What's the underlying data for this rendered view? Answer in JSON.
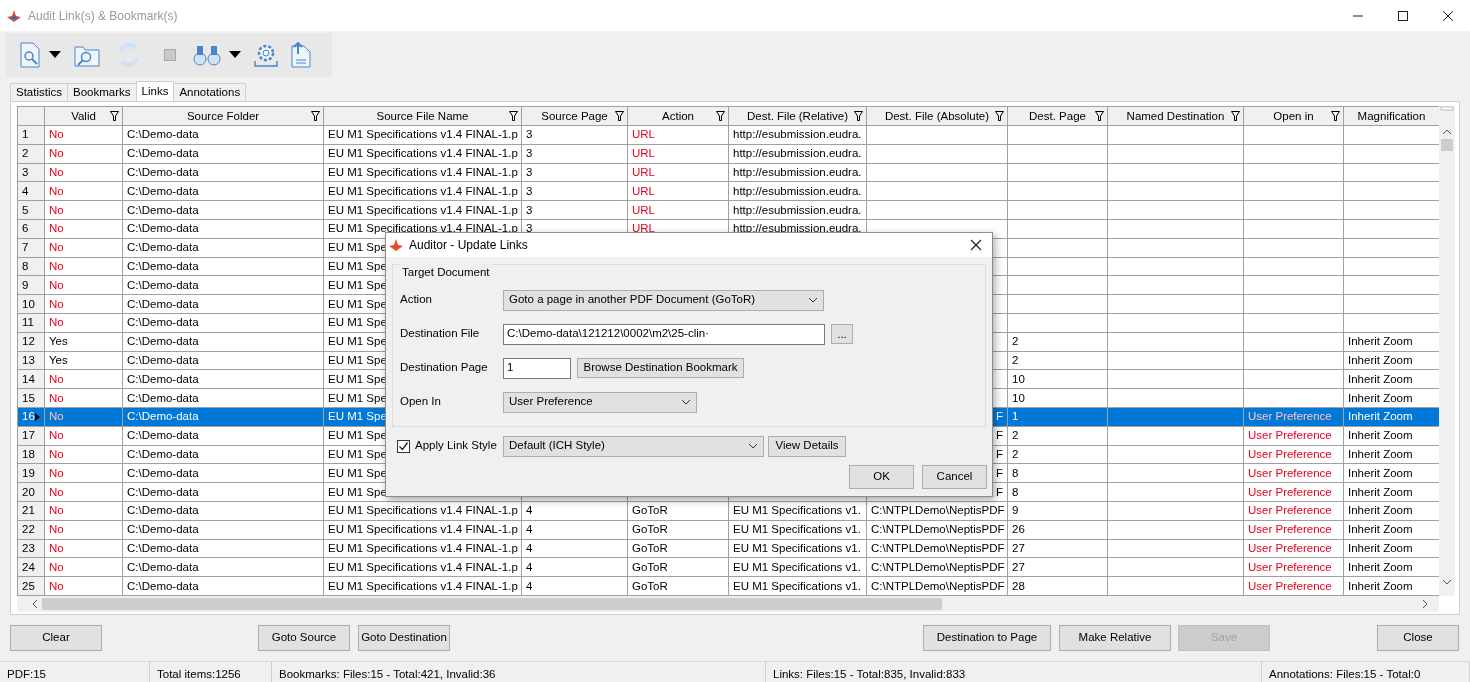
{
  "window": {
    "title": "Audit Link(s) & Bookmark(s)"
  },
  "tabs": [
    {
      "label": "Statistics",
      "selected": false
    },
    {
      "label": "Bookmarks",
      "selected": false
    },
    {
      "label": "Links",
      "selected": true
    },
    {
      "label": "Annotations",
      "selected": false
    }
  ],
  "table": {
    "columns": [
      {
        "label": "Valid",
        "filter": true
      },
      {
        "label": "Source Folder",
        "filter": true
      },
      {
        "label": "Source File Name",
        "filter": true
      },
      {
        "label": "Source Page",
        "filter": true
      },
      {
        "label": "Action",
        "filter": true
      },
      {
        "label": "Dest. File (Relative)",
        "filter": true
      },
      {
        "label": "Dest. File (Absolute)",
        "filter": true
      },
      {
        "label": "Dest. Page",
        "filter": true
      },
      {
        "label": "Named Destination",
        "filter": true
      },
      {
        "label": "Open in",
        "filter": true
      },
      {
        "label": "Magnification",
        "filter": false
      }
    ],
    "rows": [
      {
        "number": "1",
        "valid": "No",
        "invalid": true,
        "source_folder": "C:\\Demo-data",
        "source_file": "EU M1 Specifications v1.4 FINAL-1.p",
        "source_page": "3",
        "action": "URL",
        "action_flagged": true,
        "dest_relative": "http://esubmission.eudra.",
        "selected": false
      },
      {
        "number": "2",
        "valid": "No",
        "invalid": true,
        "source_folder": "C:\\Demo-data",
        "source_file": "EU M1 Specifications v1.4 FINAL-1.p",
        "source_page": "3",
        "action": "URL",
        "action_flagged": true,
        "dest_relative": "http://esubmission.eudra.",
        "selected": false
      },
      {
        "number": "3",
        "valid": "No",
        "invalid": true,
        "source_folder": "C:\\Demo-data",
        "source_file": "EU M1 Specifications v1.4 FINAL-1.p",
        "source_page": "3",
        "action": "URL",
        "action_flagged": true,
        "dest_relative": "http://esubmission.eudra.",
        "selected": false
      },
      {
        "number": "4",
        "valid": "No",
        "invalid": true,
        "source_folder": "C:\\Demo-data",
        "source_file": "EU M1 Specifications v1.4 FINAL-1.p",
        "source_page": "3",
        "action": "URL",
        "action_flagged": true,
        "dest_relative": "http://esubmission.eudra.",
        "selected": false
      },
      {
        "number": "5",
        "valid": "No",
        "invalid": true,
        "source_folder": "C:\\Demo-data",
        "source_file": "EU M1 Specifications v1.4 FINAL-1.p",
        "source_page": "3",
        "action": "URL",
        "action_flagged": true,
        "dest_relative": "http://esubmission.eudra.",
        "selected": false
      },
      {
        "number": "6",
        "valid": "No",
        "invalid": true,
        "source_folder": "C:\\Demo-data",
        "source_file": "EU M1 Specifications v1.4 FINAL-1.p",
        "source_page": "3",
        "action": "URL",
        "action_flagged": true,
        "dest_relative": "http://esubmission.eudra.",
        "selected": false
      },
      {
        "number": "7",
        "valid": "No",
        "invalid": true,
        "source_folder": "C:\\Demo-data",
        "source_file": "EU M1 Spe",
        "selected": false
      },
      {
        "number": "8",
        "valid": "No",
        "invalid": true,
        "source_folder": "C:\\Demo-data",
        "source_file": "EU M1 Spe",
        "selected": false
      },
      {
        "number": "9",
        "valid": "No",
        "invalid": true,
        "source_folder": "C:\\Demo-data",
        "source_file": "EU M1 Spe",
        "selected": false
      },
      {
        "number": "10",
        "valid": "No",
        "invalid": true,
        "source_folder": "C:\\Demo-data",
        "source_file": "EU M1 Spe",
        "selected": false
      },
      {
        "number": "11",
        "valid": "No",
        "invalid": true,
        "source_folder": "C:\\Demo-data",
        "source_file": "EU M1 Spe",
        "selected": false
      },
      {
        "number": "12",
        "valid": "Yes",
        "invalid": false,
        "source_folder": "C:\\Demo-data",
        "source_file": "EU M1 Spe",
        "dest_page": "2",
        "magnification": "Inherit Zoom",
        "selected": false
      },
      {
        "number": "13",
        "valid": "Yes",
        "invalid": false,
        "source_folder": "C:\\Demo-data",
        "source_file": "EU M1 Spe",
        "dest_page": "2",
        "magnification": "Inherit Zoom",
        "selected": false
      },
      {
        "number": "14",
        "valid": "No",
        "invalid": true,
        "source_folder": "C:\\Demo-data",
        "source_file": "EU M1 Spe",
        "dest_page": "10",
        "magnification": "Inherit Zoom",
        "selected": false
      },
      {
        "number": "15",
        "valid": "No",
        "invalid": true,
        "source_folder": "C:\\Demo-data",
        "source_file": "EU M1 Spe",
        "dest_page": "10",
        "magnification": "Inherit Zoom",
        "selected": false
      },
      {
        "number": "16",
        "valid": "No",
        "invalid": true,
        "source_folder": "C:\\Demo-data",
        "source_file": "EU M1 Spe",
        "dest_absolute": "F",
        "dest_page": "1",
        "open_in": "User Preference",
        "magnification": "Inherit Zoom",
        "selected": true
      },
      {
        "number": "17",
        "valid": "No",
        "invalid": true,
        "source_folder": "C:\\Demo-data",
        "source_file": "EU M1 Spe",
        "dest_absolute": "F",
        "dest_page": "2",
        "open_in": "User Preference",
        "magnification": "Inherit Zoom",
        "selected": false
      },
      {
        "number": "18",
        "valid": "No",
        "invalid": true,
        "source_folder": "C:\\Demo-data",
        "source_file": "EU M1 Spe",
        "dest_absolute": "F",
        "dest_page": "2",
        "open_in": "User Preference",
        "magnification": "Inherit Zoom",
        "selected": false
      },
      {
        "number": "19",
        "valid": "No",
        "invalid": true,
        "source_folder": "C:\\Demo-data",
        "source_file": "EU M1 Spe",
        "dest_absolute": "F",
        "dest_page": "8",
        "open_in": "User Preference",
        "magnification": "Inherit Zoom",
        "selected": false
      },
      {
        "number": "20",
        "valid": "No",
        "invalid": true,
        "source_folder": "C:\\Demo-data",
        "source_file": "EU M1 Spe",
        "dest_absolute": "F",
        "dest_page": "8",
        "open_in": "User Preference",
        "magnification": "Inherit Zoom",
        "selected": false
      },
      {
        "number": "21",
        "valid": "No",
        "invalid": true,
        "source_folder": "C:\\Demo-data",
        "source_file": "EU M1 Specifications v1.4 FINAL-1.p",
        "source_page": "4",
        "action": "GoToR",
        "action_flagged": false,
        "dest_relative": "EU M1 Specifications v1.",
        "dest_absolute": "C:\\NTPLDemo\\NeptisPDF",
        "dest_page": "9",
        "open_in": "User Preference",
        "magnification": "Inherit Zoom",
        "selected": false
      },
      {
        "number": "22",
        "valid": "No",
        "invalid": true,
        "source_folder": "C:\\Demo-data",
        "source_file": "EU M1 Specifications v1.4 FINAL-1.p",
        "source_page": "4",
        "action": "GoToR",
        "action_flagged": false,
        "dest_relative": "EU M1 Specifications v1.",
        "dest_absolute": "C:\\NTPLDemo\\NeptisPDF",
        "dest_page": "26",
        "open_in": "User Preference",
        "magnification": "Inherit Zoom",
        "selected": false
      },
      {
        "number": "23",
        "valid": "No",
        "invalid": true,
        "source_folder": "C:\\Demo-data",
        "source_file": "EU M1 Specifications v1.4 FINAL-1.p",
        "source_page": "4",
        "action": "GoToR",
        "action_flagged": false,
        "dest_relative": "EU M1 Specifications v1.",
        "dest_absolute": "C:\\NTPLDemo\\NeptisPDF",
        "dest_page": "27",
        "open_in": "User Preference",
        "magnification": "Inherit Zoom",
        "selected": false
      },
      {
        "number": "24",
        "valid": "No",
        "invalid": true,
        "source_folder": "C:\\Demo-data",
        "source_file": "EU M1 Specifications v1.4 FINAL-1.p",
        "source_page": "4",
        "action": "GoToR",
        "action_flagged": false,
        "dest_relative": "EU M1 Specifications v1.",
        "dest_absolute": "C:\\NTPLDemo\\NeptisPDF",
        "dest_page": "27",
        "open_in": "User Preference",
        "magnification": "Inherit Zoom",
        "selected": false
      },
      {
        "number": "25",
        "valid": "No",
        "invalid": true,
        "source_folder": "C:\\Demo-data",
        "source_file": "EU M1 Specifications v1.4 FINAL-1.p",
        "source_page": "4",
        "action": "GoToR",
        "action_flagged": false,
        "dest_relative": "EU M1 Specifications v1.",
        "dest_absolute": "C:\\NTPLDemo\\NeptisPDF",
        "dest_page": "28",
        "open_in": "User Preference",
        "magnification": "Inherit Zoom",
        "selected": false
      }
    ]
  },
  "dialog": {
    "title": "Auditor - Update Links",
    "group_label": "Target Document",
    "fields": [
      {
        "kind": "select",
        "label": "Action",
        "value": "Goto a page in another PDF Document (GoToR)"
      },
      {
        "kind": "file",
        "label": "Destination File",
        "value": "C:\\Demo-data\\121212\\0002\\m2\\25-clin·",
        "button": "..."
      },
      {
        "kind": "page",
        "label": "Destination Page",
        "value": "1",
        "button": "Browse Destination Bookmark"
      },
      {
        "kind": "select_short",
        "label": "Open In",
        "value": "User Preference"
      }
    ],
    "apply_style": {
      "label": "Apply Link Style",
      "checked": true,
      "value": "Default (ICH Style)",
      "button": "View Details"
    },
    "buttons": [
      "OK",
      "Cancel"
    ]
  },
  "buttons": [
    {
      "label": "Clear",
      "disabled": false
    },
    {
      "label": "Goto Source",
      "disabled": false
    },
    {
      "label": "Goto Destination",
      "disabled": false
    },
    {
      "label": "Destination to Page",
      "disabled": false
    },
    {
      "label": "Make Relative",
      "disabled": false
    },
    {
      "label": "Save",
      "disabled": true
    },
    {
      "label": "Close",
      "disabled": false
    }
  ],
  "status_bar": [
    "PDF:15",
    "Total items:1256",
    "Bookmarks: Files:15 - Total:421, Invalid:36",
    "Links: Files:15 - Total:835, Invalid:833",
    "Annotations: Files:15 - Total:0"
  ]
}
